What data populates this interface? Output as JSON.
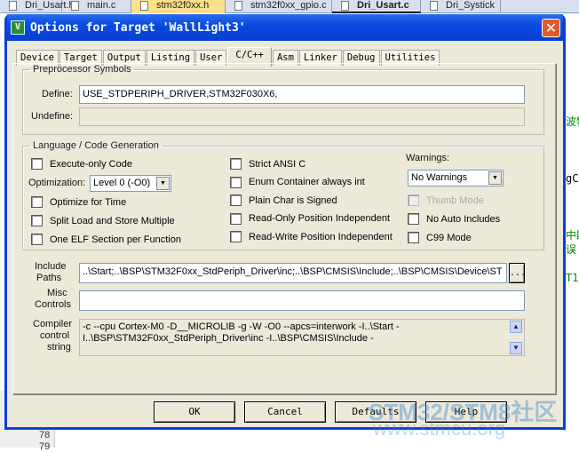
{
  "editor": {
    "tabs": [
      "Dri_Usart.h",
      "main.c",
      "stm32f0xx.h",
      "stm32f0xx_gpio.c",
      "Dri_Usart.c",
      "Dri_Systick"
    ],
    "active_tab": "stm32f0xx.h",
    "current_tab": "Dri_Usart.c",
    "line_numbers": [
      "78",
      "79"
    ],
    "code_fragments": [
      "波特",
      "gCo",
      "中断",
      "误",
      "T1"
    ]
  },
  "dialog": {
    "title": "Options for Target 'WallLight3'",
    "icon": "keil-icon",
    "close": "✕",
    "tabs": [
      "Device",
      "Target",
      "Output",
      "Listing",
      "User",
      "C/C++",
      "Asm",
      "Linker",
      "Debug",
      "Utilities"
    ],
    "selected_tab": "C/C++",
    "preprocessor": {
      "legend": "Preprocessor Symbols",
      "define_label": "Define:",
      "define_value": "USE_STDPERIPH_DRIVER,STM32F030X6,",
      "undefine_label": "Undefine:",
      "undefine_value": ""
    },
    "language": {
      "legend": "Language / Code Generation",
      "col1": [
        {
          "label": "Execute-only Code",
          "checked": false
        }
      ],
      "optimization_label": "Optimization:",
      "optimization_value": "Level 0 (-O0)",
      "col1b": [
        {
          "label": "Optimize for Time",
          "checked": false
        },
        {
          "label": "Split Load and Store Multiple",
          "checked": false
        },
        {
          "label": "One ELF Section per Function",
          "checked": false
        }
      ],
      "col2": [
        {
          "label": "Strict ANSI C",
          "checked": false
        },
        {
          "label": "Enum Container always int",
          "checked": false
        },
        {
          "label": "Plain Char is Signed",
          "checked": false
        },
        {
          "label": "Read-Only Position Independent",
          "checked": false
        },
        {
          "label": "Read-Write Position Independent",
          "checked": false
        }
      ],
      "warnings_label": "Warnings:",
      "warnings_value": "No Warnings",
      "col3": [
        {
          "label": "Thumb Mode",
          "checked": false,
          "disabled": true
        },
        {
          "label": "No Auto Includes",
          "checked": false
        },
        {
          "label": "C99 Mode",
          "checked": false
        }
      ]
    },
    "include": {
      "label1": "Include",
      "label2": "Paths",
      "value": "..\\Start;..\\BSP\\STM32F0xx_StdPeriph_Driver\\inc;..\\BSP\\CMSIS\\Include;..\\BSP\\CMSIS\\Device\\ST",
      "browse": "..."
    },
    "misc": {
      "label1": "Misc",
      "label2": "Controls",
      "value": ""
    },
    "compiler": {
      "label1": "Compiler",
      "label2": "control",
      "label3": "string",
      "line1": "-c --cpu Cortex-M0 -D__MICROLIB -g -W -O0 --apcs=interwork -I..\\Start -",
      "line2": "I..\\BSP\\STM32F0xx_StdPeriph_Driver\\inc -I..\\BSP\\CMSIS\\Include -"
    },
    "buttons": {
      "ok": "OK",
      "cancel": "Cancel",
      "defaults": "Defaults",
      "help": "Help"
    }
  },
  "watermark": {
    "line1": "STM32/STM8社区",
    "line2": "www.stmcu.org"
  }
}
